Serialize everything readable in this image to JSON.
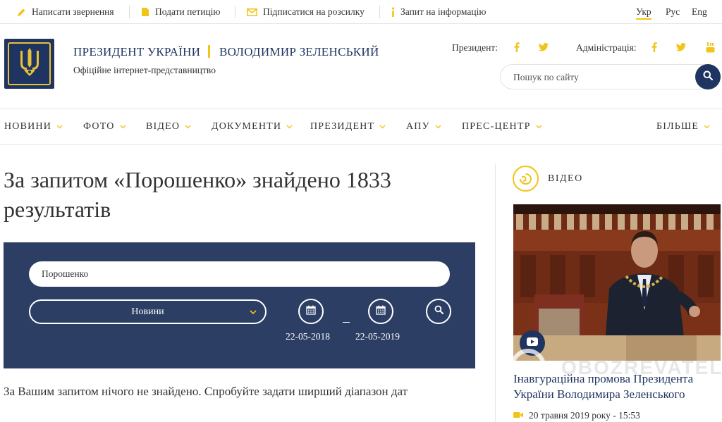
{
  "topbar": {
    "links": [
      {
        "label": "Написати звернення",
        "icon": "pencil-icon"
      },
      {
        "label": "Подати петицію",
        "icon": "document-icon"
      },
      {
        "label": "Підписатися на розсилку",
        "icon": "envelope-icon"
      },
      {
        "label": "Запит на інформацію",
        "icon": "info-icon"
      }
    ],
    "languages": [
      {
        "label": "Укр",
        "active": true
      },
      {
        "label": "Рус",
        "active": false
      },
      {
        "label": "Eng",
        "active": false
      }
    ]
  },
  "header": {
    "logo_icon": "trident-coat-of-arms-icon",
    "title": "ПРЕЗИДЕНТ УКРАЇНИ",
    "name": "ВОЛОДИМИР ЗЕЛЕНСЬКИЙ",
    "subtitle": "Офіційне інтернет-представництво",
    "social": {
      "president_label": "Президент:",
      "president_icons": [
        "facebook-icon",
        "twitter-icon"
      ],
      "administration_label": "Адміністрація:",
      "administration_icons": [
        "facebook-icon",
        "twitter-icon",
        "youtube-icon"
      ]
    },
    "search_placeholder": "Пошук по сайту"
  },
  "nav": {
    "items": [
      "НОВИНИ",
      "ФОТО",
      "ВІДЕО",
      "ДОКУМЕНТИ",
      "ПРЕЗИДЕНТ",
      "АПУ",
      "ПРЕС-ЦЕНТР"
    ],
    "more": "БІЛЬШЕ"
  },
  "results": {
    "title": "За запитом «Порошенко» знайдено 1833 результатів",
    "query": "Порошенко",
    "section": "Новини",
    "date_from": "22-05-2018",
    "date_to": "22-05-2019",
    "message": "За Вашим запитом нічого не знайдено. Спробуйте задати ширший діапазон дат"
  },
  "sidebar": {
    "title": "ВІДЕО",
    "video_caption": "Інавгураційна промова Президента України Володимира Зеленського",
    "video_date": "20 травня 2019 року - 15:53",
    "watermark": "OBOZREVATEL"
  },
  "colors": {
    "navy": "#1f3460",
    "panel": "#2c3e63",
    "gold": "#f0c419",
    "text": "#333333"
  }
}
